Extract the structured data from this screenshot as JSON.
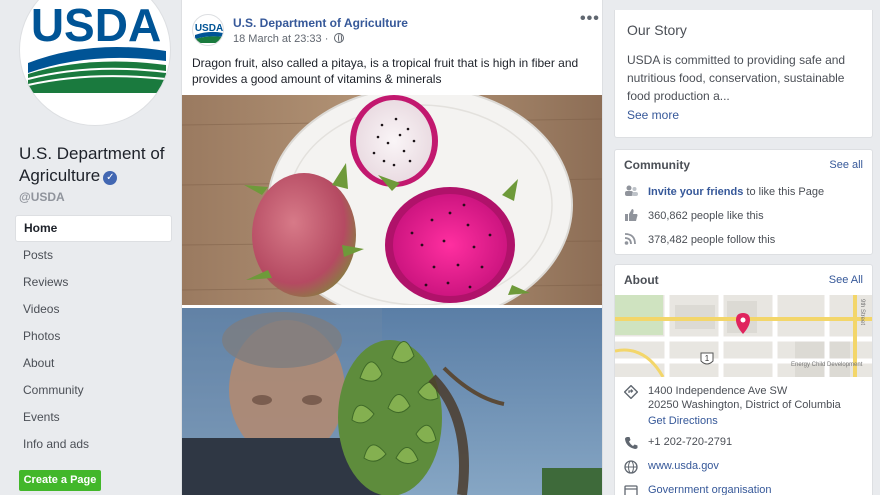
{
  "page": {
    "logo_text": "USDA",
    "name": "U.S. Department of Agriculture",
    "handle": "@USDA"
  },
  "nav": {
    "items": [
      "Home",
      "Posts",
      "Reviews",
      "Videos",
      "Photos",
      "About",
      "Community",
      "Events",
      "Info and ads"
    ],
    "active": "Home",
    "create_page_label": "Create a Page"
  },
  "post": {
    "author": "U.S. Department of Agriculture",
    "timestamp": "18 March at 23:33",
    "privacy_icon": "globe-icon",
    "more_label": "•••",
    "text": "Dragon fruit, also called a pitaya, is a tropical fruit that is high in fiber and provides a good amount of vitamins & minerals"
  },
  "our_story": {
    "title": "Our Story",
    "text": "USDA is committed to providing safe and nutritious food, conservation, sustainable food production a...",
    "see_more": "See more"
  },
  "community": {
    "title": "Community",
    "see_all": "See all",
    "invite_link": "Invite your friends",
    "invite_suffix": " to like this Page",
    "likes": "360,862 people like this",
    "follows": "378,482 people follow this"
  },
  "about": {
    "title": "About",
    "see_all": "See All",
    "map": {
      "street_label": "9th Street",
      "poi_label": "Energy Child Development",
      "route_shield": "1"
    },
    "address_line1": "1400 Independence Ave SW",
    "address_line2": "20250 Washington, District of Columbia",
    "directions": "Get Directions",
    "phone": "+1 202-720-2791",
    "website": "www.usda.gov",
    "category": "Government organisation"
  },
  "colors": {
    "link": "#365899",
    "usda_blue": "#005496",
    "usda_green": "#1a7a3e",
    "verified": "#4267b2",
    "create_button": "#42b72a",
    "map_pin": "#e0245e"
  }
}
